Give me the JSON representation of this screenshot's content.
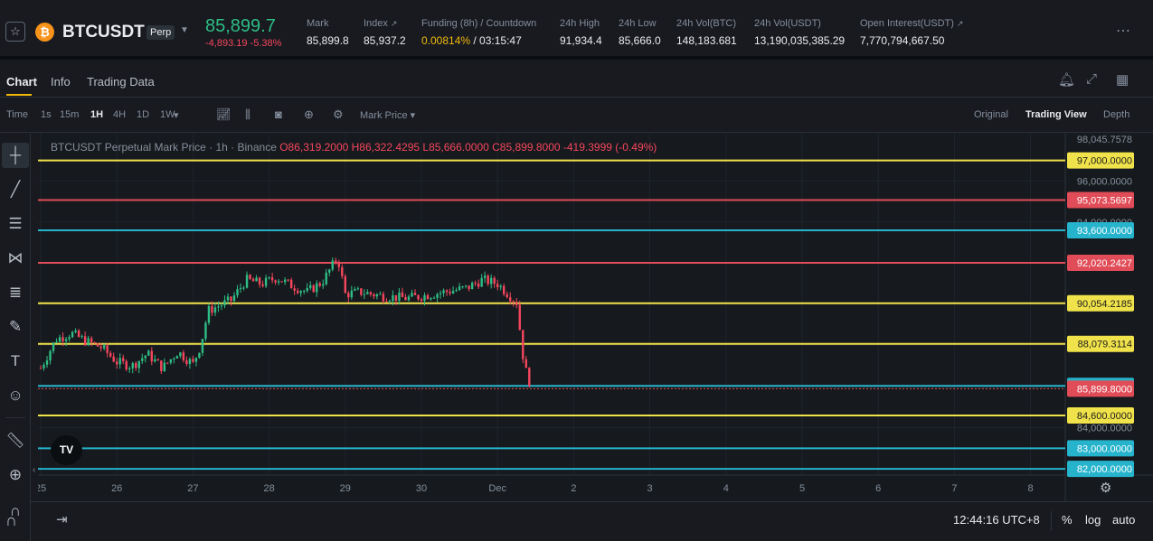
{
  "ticker": {
    "star_icon": "star-outline-icon",
    "coin_icon": "bitcoin-icon",
    "coin_glyph": "₿",
    "symbol": "BTCUSDT",
    "badge": "Perp",
    "last_price": "85,899.7",
    "change": "-4,893.19 -5.38%",
    "stats": [
      {
        "label": "Mark",
        "value": "85,899.8"
      },
      {
        "label": "Index",
        "value": "85,937.2"
      },
      {
        "label": "Funding (8h) / Countdown",
        "rate": "0.00814%",
        "countdown": "/ 03:15:47"
      },
      {
        "label": "24h High",
        "value": "91,934.4"
      },
      {
        "label": "24h Low",
        "value": "85,666.0"
      },
      {
        "label": "24h Vol(BTC)",
        "value": "148,183.681"
      },
      {
        "label": "24h Vol(USDT)",
        "value": "13,190,035,385.29"
      },
      {
        "label": "Open Interest(USDT)",
        "value": "7,770,794,667.50"
      }
    ],
    "colors": {
      "up": "#2ebd85",
      "down": "#f6465d",
      "accent": "#f0b90b"
    }
  },
  "tabs": [
    {
      "label": "Chart",
      "active": true
    },
    {
      "label": "Info",
      "active": false
    },
    {
      "label": "Trading Data",
      "active": false
    }
  ],
  "toolbar": {
    "time_label": "Time",
    "intervals": [
      {
        "label": "1s",
        "active": false
      },
      {
        "label": "15m",
        "active": false
      },
      {
        "label": "1H",
        "active": true
      },
      {
        "label": "4H",
        "active": false
      },
      {
        "label": "1D",
        "active": false
      },
      {
        "label": "1W",
        "active": false
      }
    ],
    "price_type": "Mark Price",
    "views": [
      {
        "label": "Original",
        "active": false
      },
      {
        "label": "Trading View",
        "active": true
      },
      {
        "label": "Depth",
        "active": false
      }
    ]
  },
  "chart_data": {
    "type": "candlestick",
    "legend": {
      "title": "BTCUSDT Perpetual Mark Price · 1h · Binance",
      "open": "O86,319.2000",
      "high": "H86,322.4295",
      "low": "L85,666.0000",
      "close": "C85,899.8000",
      "change": "-419.3999 (-0.49%)"
    },
    "x_ticks": [
      "25",
      "26",
      "27",
      "28",
      "29",
      "30",
      "Dec",
      "2",
      "3",
      "4",
      "5",
      "6",
      "7",
      "8"
    ],
    "y_ticks": [
      "98,045.7578",
      "96,000.0000",
      "94,000.0000",
      "84,000.0000"
    ],
    "y_range": [
      81700,
      98300
    ],
    "horizontal_lines": [
      {
        "price": 97000,
        "label": "97,000.0000",
        "color": "#f0e24a"
      },
      {
        "price": 95073.5697,
        "label": "95,073.5697",
        "color": "#e04c57"
      },
      {
        "price": 93600,
        "label": "93,600.0000",
        "color": "#26b3cc"
      },
      {
        "price": 92020.2427,
        "label": "92,020.2427",
        "color": "#e04c57"
      },
      {
        "price": 90054.2185,
        "label": "90,054.2185",
        "color": "#f0e24a"
      },
      {
        "price": 88079.3114,
        "label": "88,079.3114",
        "color": "#f0e24a"
      },
      {
        "price": 86034.1457,
        "label": "86,034.1457",
        "color": "#26b3cc"
      },
      {
        "price": 84600,
        "label": "84,600.0000",
        "color": "#f0e24a"
      },
      {
        "price": 83000,
        "label": "83,000.0000",
        "color": "#26b3cc"
      },
      {
        "price": 82000,
        "label": "82,000.0000",
        "color": "#26b3cc"
      }
    ],
    "last_price": {
      "price": 85899.8,
      "label": "85,899.8000",
      "color": "#e04c57"
    },
    "close_path": [
      {
        "day": 25.0,
        "price": 86900
      },
      {
        "day": 25.2,
        "price": 88300
      },
      {
        "day": 25.4,
        "price": 88600
      },
      {
        "day": 25.6,
        "price": 88200
      },
      {
        "day": 25.8,
        "price": 87900
      },
      {
        "day": 26.0,
        "price": 87200
      },
      {
        "day": 26.2,
        "price": 87000
      },
      {
        "day": 26.4,
        "price": 87600
      },
      {
        "day": 26.6,
        "price": 86900
      },
      {
        "day": 26.8,
        "price": 87700
      },
      {
        "day": 27.0,
        "price": 87100
      },
      {
        "day": 27.1,
        "price": 88000
      },
      {
        "day": 27.2,
        "price": 89700
      },
      {
        "day": 27.5,
        "price": 90200
      },
      {
        "day": 27.7,
        "price": 91200
      },
      {
        "day": 27.9,
        "price": 91000
      },
      {
        "day": 28.1,
        "price": 91300
      },
      {
        "day": 28.3,
        "price": 90900
      },
      {
        "day": 28.5,
        "price": 90600
      },
      {
        "day": 28.7,
        "price": 91100
      },
      {
        "day": 28.9,
        "price": 92300
      },
      {
        "day": 29.0,
        "price": 90500
      },
      {
        "day": 29.2,
        "price": 90600
      },
      {
        "day": 29.5,
        "price": 90400
      },
      {
        "day": 29.8,
        "price": 90300
      },
      {
        "day": 30.0,
        "price": 90400
      },
      {
        "day": 30.3,
        "price": 90600
      },
      {
        "day": 30.6,
        "price": 90800
      },
      {
        "day": 30.8,
        "price": 91200
      },
      {
        "day": 31.0,
        "price": 91000
      },
      {
        "day": 31.25,
        "price": 90100
      },
      {
        "day": 31.35,
        "price": 87000
      },
      {
        "day": 31.45,
        "price": 85900
      }
    ],
    "colors": {
      "up": "#2ebd85",
      "down": "#f6465d"
    }
  },
  "bottom": {
    "time": "12:44:16 UTC+8",
    "percent": "%",
    "log": "log",
    "auto": "auto"
  }
}
